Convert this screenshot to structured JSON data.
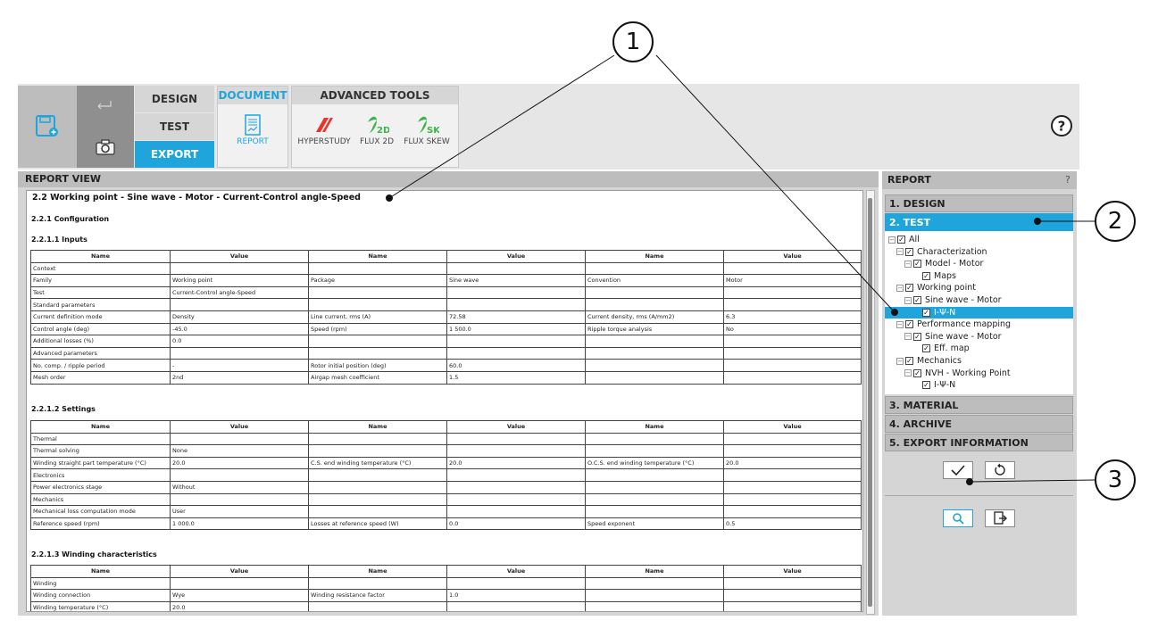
{
  "toolbar": {
    "tabs": [
      "DESIGN",
      "TEST",
      "EXPORT"
    ],
    "active_tab": "EXPORT",
    "document_group": {
      "title": "DOCUMENT",
      "items": [
        {
          "label": "REPORT",
          "icon": "report-icon"
        }
      ]
    },
    "advanced_group": {
      "title": "ADVANCED TOOLS",
      "items": [
        {
          "label": "HYPERSTUDY",
          "icon": "hyperstudy-icon"
        },
        {
          "label": "FLUX 2D",
          "icon": "flux-2d-icon",
          "badge": "2D"
        },
        {
          "label": "FLUX SKEW",
          "icon": "flux-skew-icon",
          "badge": "SK"
        }
      ]
    },
    "help_label": "?"
  },
  "report_view": {
    "header": "REPORT VIEW",
    "title": "2.2 Working point - Sine wave - Motor - Current-Control angle-Speed",
    "configuration": "2.2.1 Configuration",
    "sections": [
      {
        "heading": "2.2.1.1 Inputs",
        "columns": [
          "Name",
          "Value",
          "Name",
          "Value",
          "Name",
          "Value"
        ],
        "rows": [
          [
            "Context",
            "",
            "",
            "",
            "",
            ""
          ],
          [
            "Family",
            "Working point",
            "Package",
            "Sine wave",
            "Convention",
            "Motor"
          ],
          [
            "Test",
            "Current-Control angle-Speed",
            "",
            "",
            "",
            ""
          ],
          [
            "Standard parameters",
            "",
            "",
            "",
            "",
            ""
          ],
          [
            "Current definition mode",
            "Density",
            "Line current, rms (A)",
            "72.58",
            "Current density, rms (A/mm2)",
            "6.3"
          ],
          [
            "Control angle (deg)",
            "-45.0",
            "Speed (rpm)",
            "1 500.0",
            "Ripple torque analysis",
            "No"
          ],
          [
            "Additional losses (%)",
            "0.0",
            "",
            "",
            "",
            ""
          ],
          [
            "Advanced parameters",
            "",
            "",
            "",
            "",
            ""
          ],
          [
            "No. comp. / ripple period",
            "-",
            "Rotor initial position (deg)",
            "60.0",
            "",
            ""
          ],
          [
            "Mesh order",
            "2nd",
            "Airgap mesh coefficient",
            "1.5",
            "",
            ""
          ]
        ]
      },
      {
        "heading": "2.2.1.2 Settings",
        "columns": [
          "Name",
          "Value",
          "Name",
          "Value",
          "Name",
          "Value"
        ],
        "rows": [
          [
            "Thermal",
            "",
            "",
            "",
            "",
            ""
          ],
          [
            "Thermal solving",
            "None",
            "",
            "",
            "",
            ""
          ],
          [
            "Winding straight part temperature (°C)",
            "20.0",
            "C.S. end winding temperature (°C)",
            "20.0",
            "O.C.S. end winding temperature (°C)",
            "20.0"
          ],
          [
            "Electronics",
            "",
            "",
            "",
            "",
            ""
          ],
          [
            "Power electronics stage",
            "Without",
            "",
            "",
            "",
            ""
          ],
          [
            "Mechanics",
            "",
            "",
            "",
            "",
            ""
          ],
          [
            "Mechanical loss computation mode",
            "User",
            "",
            "",
            "",
            ""
          ],
          [
            "Reference speed (rpm)",
            "1 000.0",
            "Losses at reference speed (W)",
            "0.0",
            "Speed exponent",
            "0.5"
          ]
        ]
      },
      {
        "heading": "2.2.1.3 Winding characteristics",
        "columns": [
          "Name",
          "Value",
          "Name",
          "Value",
          "Name",
          "Value"
        ],
        "rows": [
          [
            "Winding",
            "",
            "",
            "",
            "",
            ""
          ],
          [
            "Winding connection",
            "Wye",
            "Winding resistance factor",
            "1.0",
            "",
            ""
          ],
          [
            "Winding temperature (°C)",
            "20.0",
            "",
            "",
            "",
            ""
          ]
        ]
      }
    ]
  },
  "report_panel": {
    "header": "REPORT",
    "help": "?",
    "accordion": [
      "1. DESIGN",
      "2. TEST",
      "3. MATERIAL",
      "4. ARCHIVE",
      "5. EXPORT INFORMATION"
    ],
    "active_section": "2. TEST",
    "tree": [
      {
        "label": "All",
        "level": 0,
        "expander": true
      },
      {
        "label": "Characterization",
        "level": 1,
        "expander": true
      },
      {
        "label": "Model - Motor",
        "level": 2,
        "expander": true
      },
      {
        "label": "Maps",
        "level": 3,
        "expander": false
      },
      {
        "label": "Working point",
        "level": 1,
        "expander": true
      },
      {
        "label": "Sine wave - Motor",
        "level": 2,
        "expander": true
      },
      {
        "label": "I-Ψ-N",
        "level": 3,
        "expander": false,
        "selected": true
      },
      {
        "label": "Performance mapping",
        "level": 1,
        "expander": true
      },
      {
        "label": "Sine wave - Motor",
        "level": 2,
        "expander": true
      },
      {
        "label": "Eff. map",
        "level": 3,
        "expander": false
      },
      {
        "label": "Mechanics",
        "level": 1,
        "expander": true
      },
      {
        "label": "NVH - Working Point",
        "level": 2,
        "expander": true
      },
      {
        "label": "I-Ψ-N",
        "level": 3,
        "expander": false
      }
    ],
    "buttons": [
      {
        "icon": "check-icon"
      },
      {
        "icon": "reset-icon"
      },
      {
        "icon": "preview-icon"
      },
      {
        "icon": "export-file-icon"
      }
    ]
  },
  "callouts": [
    "1",
    "2",
    "3"
  ],
  "colors": {
    "accent": "#1fa5dc",
    "panel": "#d5d5d5",
    "header": "#bdbdbd"
  }
}
